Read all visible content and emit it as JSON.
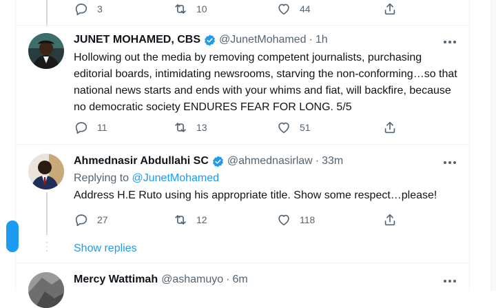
{
  "top_actions": {
    "reply_count": "3",
    "retweet_count": "10",
    "like_count": "44"
  },
  "tweets": [
    {
      "name": "JUNET MOHAMED, CBS",
      "handle": "@JunetMohamed",
      "time": "1h",
      "text": "Hollowing out the media by removing competent journalists, purchasing editorial boards, intimidating newsrooms, starving the non-conforming…so that national news starts and ends with your whims and fiat, will backfire, because no democratic society ENDURES FEAR FOR LONG. 5/5",
      "reply_count": "11",
      "retweet_count": "13",
      "like_count": "51"
    },
    {
      "name": "Ahmednasir Abdullahi SC",
      "handle": "@ahmednasirlaw",
      "time": "33m",
      "replying_label": "Replying to",
      "replying_to": "@JunetMohamed",
      "text": "Address H.E Ruto using his appropriate title. Show some respect…please!",
      "reply_count": "27",
      "retweet_count": "12",
      "like_count": "118"
    },
    {
      "name": "Mercy Wattimah",
      "handle": "@ashamuyo",
      "time": "6m"
    }
  ],
  "show_replies": "Show replies",
  "separator": "·",
  "icons": [
    "reply-icon",
    "retweet-icon",
    "like-icon",
    "share-icon",
    "more-icon",
    "verified-badge-icon"
  ],
  "colors": {
    "accent": "#1d9bf0",
    "muted": "#536471",
    "text": "#0f1419",
    "border": "#eff3f4"
  }
}
